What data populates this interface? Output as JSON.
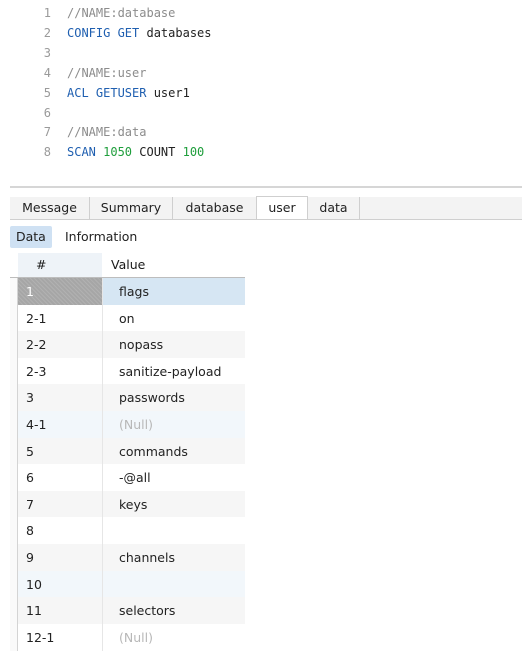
{
  "editor": {
    "lines": [
      {
        "n": "1",
        "parts": [
          {
            "t": "//NAME:database",
            "c": "comment"
          }
        ]
      },
      {
        "n": "2",
        "parts": [
          {
            "t": "CONFIG GET ",
            "c": "key"
          },
          {
            "t": "databases",
            "c": "text"
          }
        ]
      },
      {
        "n": "3",
        "parts": []
      },
      {
        "n": "4",
        "parts": [
          {
            "t": "//NAME:user",
            "c": "comment"
          }
        ]
      },
      {
        "n": "5",
        "parts": [
          {
            "t": "ACL GETUSER ",
            "c": "key"
          },
          {
            "t": "user1",
            "c": "text"
          }
        ]
      },
      {
        "n": "6",
        "parts": []
      },
      {
        "n": "7",
        "parts": [
          {
            "t": "//NAME:data",
            "c": "comment"
          }
        ]
      },
      {
        "n": "8",
        "parts": [
          {
            "t": "SCAN ",
            "c": "key"
          },
          {
            "t": "1050",
            "c": "num"
          },
          {
            "t": " COUNT ",
            "c": "text"
          },
          {
            "t": "100",
            "c": "num"
          }
        ]
      }
    ]
  },
  "result_tabs": [
    "Message",
    "Summary",
    "database",
    "user",
    "data"
  ],
  "active_tab": "user",
  "sub_tabs": [
    "Data",
    "Information"
  ],
  "active_sub_tab": "Data",
  "table": {
    "headers": [
      "#",
      "Value"
    ],
    "rows": [
      {
        "num": "1",
        "value": "flags"
      },
      {
        "num": "2-1",
        "value": "on"
      },
      {
        "num": "2-2",
        "value": "nopass"
      },
      {
        "num": "2-3",
        "value": "sanitize-payload"
      },
      {
        "num": "3",
        "value": "passwords"
      },
      {
        "num": "4-1",
        "value": "(Null)"
      },
      {
        "num": "5",
        "value": "commands"
      },
      {
        "num": "6",
        "value": "-@all"
      },
      {
        "num": "7",
        "value": "keys"
      },
      {
        "num": "8",
        "value": ""
      },
      {
        "num": "9",
        "value": "channels"
      },
      {
        "num": "10",
        "value": ""
      },
      {
        "num": "11",
        "value": "selectors"
      },
      {
        "num": "12-1",
        "value": "(Null)"
      }
    ],
    "selected_row": 0
  },
  "colors": {
    "keyword": "#1f5fb0",
    "number": "#1f9e3c",
    "comment": "#8c8c8c",
    "selection": "#d6e6f3",
    "active_subtab": "#cfe1f3"
  }
}
